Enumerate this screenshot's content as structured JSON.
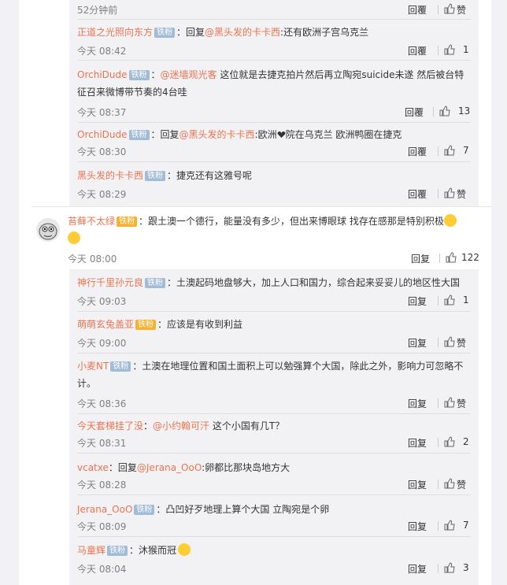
{
  "thread": [
    {
      "time": "52分钟前",
      "reply": "回覆",
      "like": "赞"
    },
    {
      "user": "正道之光照向东方",
      "badge": "铁粉",
      "text_prefix": "：回复",
      "mention": "@黑头发的卡卡西",
      "text": ":还有欧洲子宫乌克兰",
      "time": "今天 08:42",
      "reply": "回覆",
      "like": "1"
    },
    {
      "user": "OrchiDude",
      "badge": "铁粉",
      "text_prefix": "：",
      "mention": "@迷墙观光客",
      "text": " 这位就是去捷克拍片然后再立陶宛suicide未遂 然后被台特征召来微博带节奏的4台哇",
      "time": "今天 08:37",
      "reply": "回覆",
      "like": "13"
    },
    {
      "user": "OrchiDude",
      "badge": "铁粉",
      "text_prefix": "：回复",
      "mention": "@黑头发的卡卡西",
      "text": ":欧洲",
      "text_after": "院在乌克兰 欧洲鸭圈在捷克",
      "time": "今天 08:30",
      "reply": "回覆",
      "like": "7"
    },
    {
      "user": "黑头发的卡卡西",
      "badge": "铁粉",
      "text": "：捷克还有这雅号呢",
      "time": "今天 08:29",
      "reply": "回覆",
      "like": "赞"
    }
  ],
  "main_comment": {
    "user": "苔藓不太绿",
    "badge": "铁粉",
    "text": "：跟土澳一个德行，能量没有多少，但出来博眼球 找存在感那是特别积极",
    "time": "今天 08:00",
    "reply": "回复",
    "like": "122"
  },
  "replies": [
    {
      "user": "神行千里孙元良",
      "badge": "铁粉",
      "text": "：土澳起码地盘够大，加上人口和国力，综合起来妥妥儿的地区性大国",
      "time": "今天 09:03",
      "reply": "回复",
      "like": "1"
    },
    {
      "user": "萌萌玄兔盖亚",
      "badge": "铁粉",
      "text": "：应该是有收到利益",
      "time": "今天 09:00",
      "reply": "回复",
      "like": "赞"
    },
    {
      "user": "小麦NT",
      "badge": "铁粉",
      "text": "：土澳在地理位置和国土面积上可以勉强算个大国，除此之外，影响力可忽略不计。",
      "time": "今天 08:36",
      "reply": "回复",
      "like": "赞"
    },
    {
      "user": "今天套梯挂了没",
      "text_prefix": "：",
      "mention": "@小约翰可汗",
      "text": " 这个小国有几T？",
      "time": "今天 08:31",
      "reply": "回复",
      "like": "2"
    },
    {
      "user": "vcatxe",
      "text_prefix": "：回复",
      "mention": "@Jerana_OoO",
      "text": ":卵都比那块岛地方大",
      "time": "今天 08:28",
      "reply": "回复",
      "like": "赞"
    },
    {
      "user": "Jerana_OoO",
      "badge": "铁粉",
      "text": "：凸凹好歹地理上算个大国  立陶宛是个卵",
      "time": "今天 08:09",
      "reply": "回复",
      "like": "7"
    },
    {
      "user": "马童辉",
      "badge": "铁粉",
      "text": "：沐猴而冠",
      "time": "今天 08:04",
      "reply": "回复",
      "like": "3"
    }
  ],
  "colors": {
    "link": "#eb7350",
    "muted": "#808080",
    "badge": "#a3bcd6",
    "badge_gold": "#f6b12e",
    "panel": "#f2f2f5"
  }
}
